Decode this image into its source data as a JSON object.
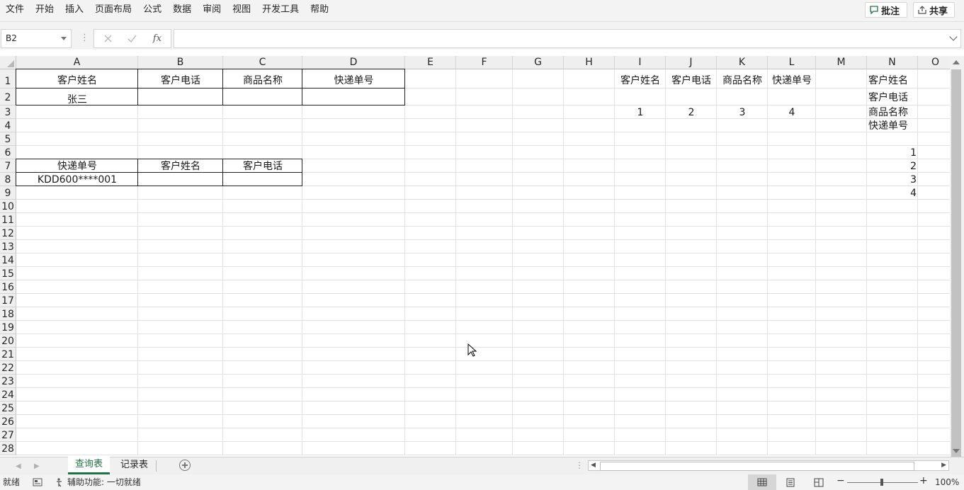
{
  "menu": [
    "文件",
    "开始",
    "插入",
    "页面布局",
    "公式",
    "数据",
    "审阅",
    "视图",
    "开发工具",
    "帮助"
  ],
  "ribbon_buttons": {
    "comments": "批注",
    "share": "共享"
  },
  "formula_bar": {
    "name_box": "B2",
    "fx": "fx",
    "formula": ""
  },
  "columns": [
    "A",
    "B",
    "C",
    "D",
    "E",
    "F",
    "G",
    "H",
    "I",
    "J",
    "K",
    "L",
    "M",
    "N",
    "O"
  ],
  "rows": [
    "1",
    "2",
    "3",
    "4",
    "5",
    "6",
    "7",
    "8",
    "9",
    "10",
    "11",
    "12",
    "13",
    "14",
    "15",
    "16",
    "17",
    "18",
    "19",
    "20",
    "21",
    "22",
    "23",
    "24",
    "25",
    "26",
    "27",
    "28"
  ],
  "cells": {
    "A1": "客户姓名",
    "B1": "客户电话",
    "C1": "商品名称",
    "D1": "快递单号",
    "A2": "张三",
    "A7": "快递单号",
    "B7": "客户姓名",
    "C7": "客户电话",
    "A8": "KDD600****001",
    "I1": "客户姓名",
    "J1": "客户电话",
    "K1": "商品名称",
    "L1": "快递单号",
    "I3": "1",
    "J3": "2",
    "K3": "3",
    "L3": "4",
    "N1": "客户姓名",
    "N2": "客户电话",
    "N3": "商品名称",
    "N4": "快递单号",
    "N6": "1",
    "N7": "2",
    "N8": "3",
    "N9": "4"
  },
  "sheets": {
    "active": "查询表",
    "other": "记录表"
  },
  "status": {
    "ready": "就绪",
    "accessibility": "辅助功能: 一切就绪",
    "zoom": "100%"
  },
  "icons": [
    "comment-icon",
    "share-icon",
    "cancel-icon",
    "enter-icon",
    "function-icon",
    "add-sheet-icon",
    "macro-icon",
    "accessibility-icon",
    "normal-view-icon",
    "page-layout-icon",
    "page-break-icon",
    "cursor-icon"
  ]
}
